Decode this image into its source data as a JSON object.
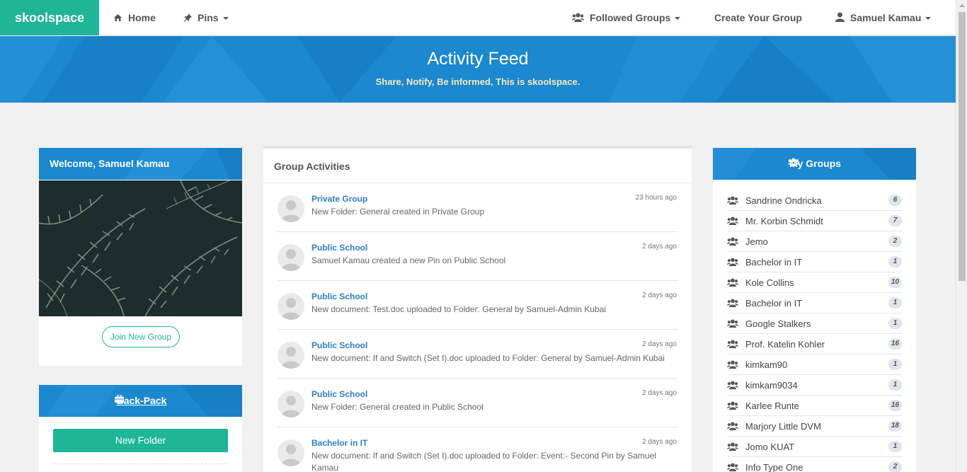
{
  "nav": {
    "brand": "skoolspace",
    "home": "Home",
    "pins": "Pins",
    "followed_groups": "Followed Groups",
    "create_group": "Create Your Group",
    "user": "Samuel Kamau"
  },
  "banner": {
    "title": "Activity Feed",
    "subtitle": "Share, Notify, Be informed, This is skoolspace."
  },
  "welcome": {
    "title": "Welcome, Samuel Kamau",
    "join_button": "Join New Group"
  },
  "backpack": {
    "title": "Back-Pack",
    "new_folder_button": "New Folder"
  },
  "activities": {
    "title": "Group Activities",
    "items": [
      {
        "group": "Private Group",
        "time": "23 hours ago",
        "text": "New Folder: General created in Private Group"
      },
      {
        "group": "Public School",
        "time": "2 days ago",
        "text": "Samuel Kamau created a new Pin on Public School"
      },
      {
        "group": "Public School",
        "time": "2 days ago",
        "text": "New document: Test.doc uploaded to Folder: General by Samuel-Admin Kubai"
      },
      {
        "group": "Public School",
        "time": "2 days ago",
        "text": "New document: If and Switch (Set I).doc uploaded to Folder: General by Samuel-Admin Kubai"
      },
      {
        "group": "Public School",
        "time": "2 days ago",
        "text": "New Folder: General created in Public School"
      },
      {
        "group": "Bachelor in IT",
        "time": "2 days ago",
        "text": "New document: If and Switch (Set I).doc uploaded to Folder: Event:- Second Pin by Samuel Kamau"
      }
    ]
  },
  "my_groups": {
    "title": "My Groups",
    "items": [
      {
        "name": "Sandrine Ondricka",
        "count": "6"
      },
      {
        "name": "Mr. Korbin Schmidt",
        "count": "7"
      },
      {
        "name": "Jemo",
        "count": "2"
      },
      {
        "name": "Bachelor in IT",
        "count": "1"
      },
      {
        "name": "Kole Collins",
        "count": "10"
      },
      {
        "name": "Bachelor in IT",
        "count": "1"
      },
      {
        "name": "Google Stalkers",
        "count": "1"
      },
      {
        "name": "Prof. Katelin Kohler",
        "count": "16"
      },
      {
        "name": "kimkam90",
        "count": "1"
      },
      {
        "name": "kimkam9034",
        "count": "1"
      },
      {
        "name": "Karlee Runte",
        "count": "16"
      },
      {
        "name": "Marjory Little DVM",
        "count": "18"
      },
      {
        "name": "Jomo KUAT",
        "count": "1"
      },
      {
        "name": "Info Type One",
        "count": "2"
      }
    ]
  },
  "colors": {
    "brand_green": "#1fb597",
    "header_blue": "#1b88d0",
    "link_blue": "#2a7fc8"
  },
  "icons": [
    "home-icon",
    "pin-icon",
    "group-icon",
    "user-icon",
    "briefcase-icon",
    "avatar-placeholder-icon"
  ]
}
